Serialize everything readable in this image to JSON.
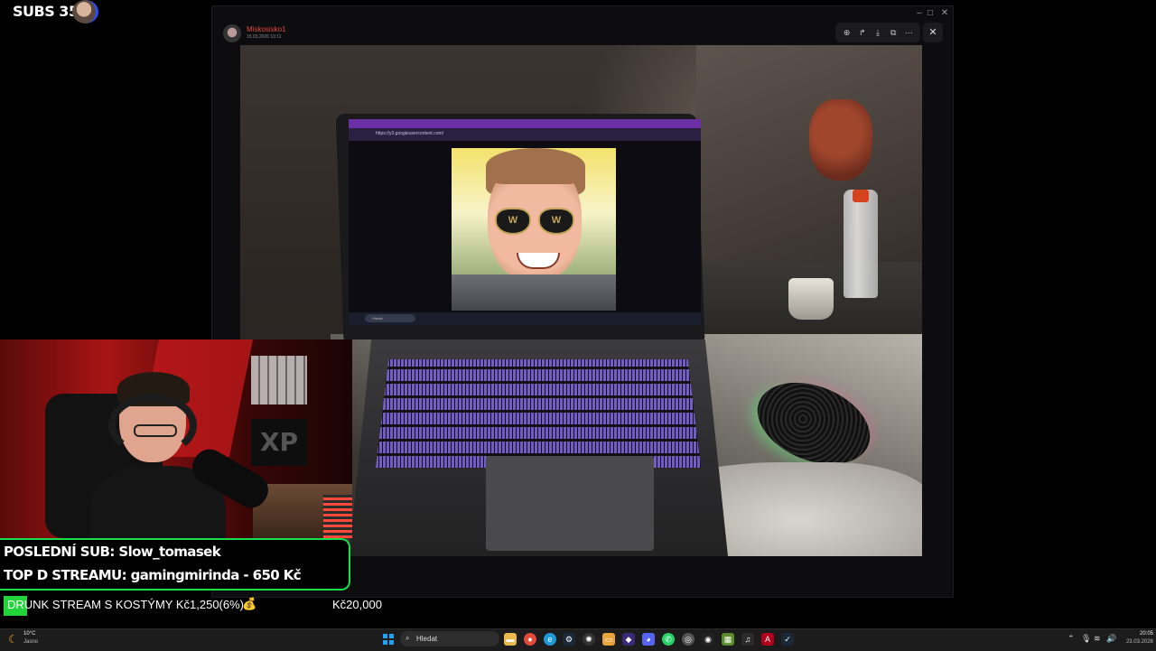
{
  "overlay": {
    "subs_counter": "SUBS 353/",
    "latest_sub": "POSLEDNÍ SUB: Slow_tomasek",
    "top_donation": "TOP D STREAMU: gamingmirinda - 650 Kč",
    "goal_text": "DRUNK STREAM S KOSTÝMY Kč1,250(6%)",
    "goal_emoji": "💰",
    "goal_target": "Kč20,000",
    "goal_progress": 0.06,
    "accent_color": "#19e04a"
  },
  "viewer": {
    "sender_name": "Miskosisko1",
    "sender_date": "15.03.2026 10:11",
    "toolbar_icons": [
      "zoom-in-icon",
      "share-icon",
      "download-icon",
      "open-external-icon",
      "more-icon"
    ],
    "close_icon": "close-icon"
  },
  "photo": {
    "laptop_url": "https://y3.googleusercontent.com/",
    "laptop_search": "Hledat"
  },
  "taskbar": {
    "weather_temp": "10°C",
    "weather_desc": "Jasno",
    "search_placeholder": "Hledat",
    "clock_time": "20:05",
    "clock_date": "23.03.2026",
    "apps": [
      "file-explorer-icon",
      "chrome-icon",
      "edge-icon",
      "steam-icon",
      "chatgpt-icon",
      "folder-icon",
      "discord-icon",
      "app-icon",
      "discord-icon",
      "whatsapp-icon",
      "sphere-icon",
      "obs-icon",
      "minecraft-icon",
      "spotify-icon",
      "acrobat-icon",
      "vscode-icon"
    ]
  }
}
